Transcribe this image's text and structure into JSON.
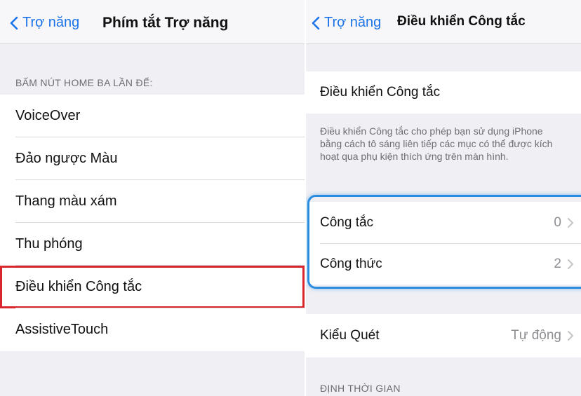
{
  "left": {
    "back_label": "Trợ năng",
    "title": "Phím tắt Trợ năng",
    "section_header": "BẤM NÚT HOME BA LẦN ĐỂ:",
    "items": [
      {
        "label": "VoiceOver"
      },
      {
        "label": "Đảo ngược Màu"
      },
      {
        "label": "Thang màu xám"
      },
      {
        "label": "Thu phóng"
      },
      {
        "label": "Điều khiển Công tắc"
      },
      {
        "label": "AssistiveTouch"
      }
    ]
  },
  "right": {
    "back_label": "Trợ năng",
    "title": "Điều khiển Công tắc",
    "switch_label": "Điều khiển Công tắc",
    "description": "Điều khiển Công tắc cho phép bạn sử dụng iPhone bằng cách tô sáng liên tiếp các mục có thể được kích hoạt qua phụ kiện thích ứng trên màn hình.",
    "rows": [
      {
        "label": "Công tắc",
        "value": "0"
      },
      {
        "label": "Công thức",
        "value": "2"
      }
    ],
    "scan_label": "Kiểu Quét",
    "scan_value": "Tự động",
    "timing_header": "ĐỊNH THỜI GIAN"
  },
  "colors": {
    "accent": "#1a73e8",
    "highlight_border": "#d9262c",
    "focus_ring": "#2a8cdf",
    "background": "#efeff4"
  },
  "icons": {
    "back": "chevron-left-icon",
    "disclosure": "chevron-right-icon"
  }
}
